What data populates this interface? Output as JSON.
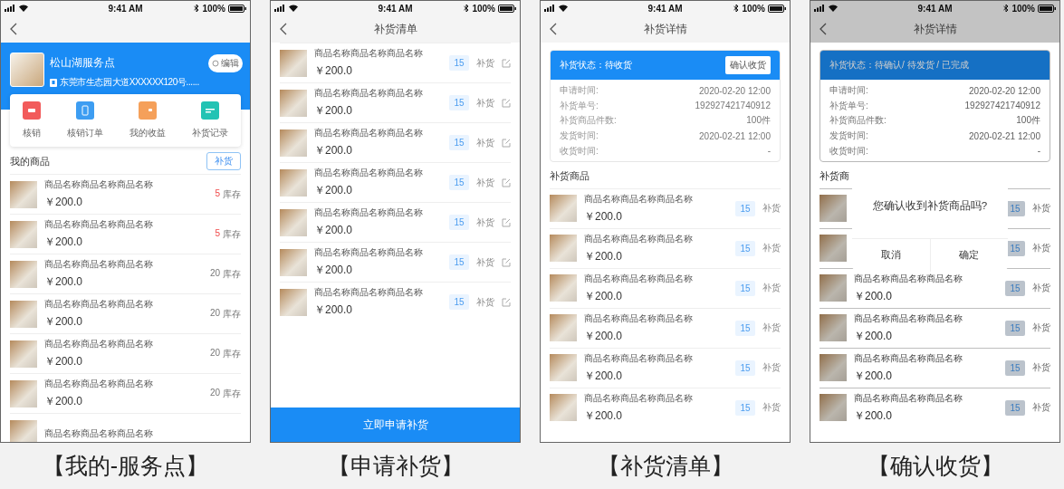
{
  "screens": [
    {
      "kind": "service_point",
      "status_bar": {
        "time": "9:41 AM",
        "battery": "100%"
      },
      "profile": {
        "name": "松山湖服务点",
        "address": "东莞市生态园大道XXXXXX120号......",
        "edit": "编辑"
      },
      "shortcuts": [
        {
          "label": "核销",
          "color": "#f25b5b"
        },
        {
          "label": "核销订单",
          "color": "#3d9df2"
        },
        {
          "label": "我的收益",
          "color": "#f5a05a"
        },
        {
          "label": "补货记录",
          "color": "#22c3b4"
        }
      ],
      "section": {
        "title": "我的商品",
        "action": "补货"
      },
      "products": [
        {
          "name": "商品名称商品名称商品名称",
          "price": "￥200.0",
          "stock": "5",
          "stock_label": "库存",
          "low": true
        },
        {
          "name": "商品名称商品名称商品名称",
          "price": "￥200.0",
          "stock": "5",
          "stock_label": "库存",
          "low": true
        },
        {
          "name": "商品名称商品名称商品名称",
          "price": "￥200.0",
          "stock": "20",
          "stock_label": "库存",
          "low": false
        },
        {
          "name": "商品名称商品名称商品名称",
          "price": "￥200.0",
          "stock": "20",
          "stock_label": "库存",
          "low": false
        },
        {
          "name": "商品名称商品名称商品名称",
          "price": "￥200.0",
          "stock": "20",
          "stock_label": "库存",
          "low": false
        },
        {
          "name": "商品名称商品名称商品名称",
          "price": "￥200.0",
          "stock": "20",
          "stock_label": "库存",
          "low": false
        },
        {
          "name": "商品名称商品名称商品名称"
        }
      ],
      "caption": "【我的-服务点】"
    },
    {
      "kind": "restock_list",
      "status_bar": {
        "time": "9:41 AM",
        "battery": "100%"
      },
      "nav": {
        "title": "补货清单"
      },
      "items": [
        {
          "name": "商品名称商品名称商品名称",
          "price": "￥200.0",
          "qty": "15",
          "action": "补货"
        },
        {
          "name": "商品名称商品名称商品名称",
          "price": "￥200.0",
          "qty": "15",
          "action": "补货"
        },
        {
          "name": "商品名称商品名称商品名称",
          "price": "￥200.0",
          "qty": "15",
          "action": "补货"
        },
        {
          "name": "商品名称商品名称商品名称",
          "price": "￥200.0",
          "qty": "15",
          "action": "补货"
        },
        {
          "name": "商品名称商品名称商品名称",
          "price": "￥200.0",
          "qty": "15",
          "action": "补货"
        },
        {
          "name": "商品名称商品名称商品名称",
          "price": "￥200.0",
          "qty": "15",
          "action": "补货"
        },
        {
          "name": "商品名称商品名称商品名称",
          "price": "￥200.0",
          "qty": "15",
          "action": "补货"
        }
      ],
      "footer_button": "立即申请补货",
      "caption": "【申请补货】"
    },
    {
      "kind": "restock_detail",
      "status_bar": {
        "time": "9:41 AM",
        "battery": "100%"
      },
      "nav": {
        "title": "补货详情"
      },
      "status": "补货状态：待收货",
      "confirm_button": "确认收货",
      "fields": [
        {
          "label": "申请时间:",
          "value": "2020-02-20 12:00"
        },
        {
          "label": "补货单号:",
          "value": "192927421740912"
        },
        {
          "label": "补货商品件数:",
          "value": "100件"
        },
        {
          "label": "发货时间:",
          "value": "2020-02-21 12:00"
        },
        {
          "label": "收货时间:",
          "value": "-"
        }
      ],
      "section_title": "补货商品",
      "items": [
        {
          "name": "商品名称商品名称商品名称",
          "price": "￥200.0",
          "qty": "15",
          "action": "补货"
        },
        {
          "name": "商品名称商品名称商品名称",
          "price": "￥200.0",
          "qty": "15",
          "action": "补货"
        },
        {
          "name": "商品名称商品名称商品名称",
          "price": "￥200.0",
          "qty": "15",
          "action": "补货"
        },
        {
          "name": "商品名称商品名称商品名称",
          "price": "￥200.0",
          "qty": "15",
          "action": "补货"
        },
        {
          "name": "商品名称商品名称商品名称",
          "price": "￥200.0",
          "qty": "15",
          "action": "补货"
        },
        {
          "name": "商品名称商品名称商品名称",
          "price": "￥200.0",
          "qty": "15",
          "action": "补货"
        }
      ],
      "caption": "【补货清单】"
    },
    {
      "kind": "restock_detail",
      "status_bar": {
        "time": "9:41 AM",
        "battery": "100%"
      },
      "nav": {
        "title": "补货详情"
      },
      "status": "补货状态：待确认/ 待发货 / 已完成",
      "fields": [
        {
          "label": "申请时间:",
          "value": "2020-02-20 12:00"
        },
        {
          "label": "补货单号:",
          "value": "192927421740912"
        },
        {
          "label": "补货商品件数:",
          "value": "100件"
        },
        {
          "label": "发货时间:",
          "value": "2020-02-21 12:00"
        },
        {
          "label": "收货时间:",
          "value": "-"
        }
      ],
      "section_title": "补货商",
      "items": [
        {
          "qty": "15",
          "action": "补货"
        },
        {
          "qty": "15",
          "action": "补货"
        },
        {
          "name": "商品名称商品名称商品名称",
          "price": "￥200.0",
          "qty": "15",
          "action": "补货"
        },
        {
          "name": "商品名称商品名称商品名称",
          "price": "￥200.0",
          "qty": "15",
          "action": "补货"
        },
        {
          "name": "商品名称商品名称商品名称",
          "price": "￥200.0",
          "qty": "15",
          "action": "补货"
        },
        {
          "name": "商品名称商品名称商品名称",
          "price": "￥200.0",
          "qty": "15",
          "action": "补货"
        }
      ],
      "dialog": {
        "message": "您确认收到补货商品吗?",
        "buttons": [
          "取消",
          "确定"
        ]
      },
      "caption": "【确认收货】"
    }
  ]
}
